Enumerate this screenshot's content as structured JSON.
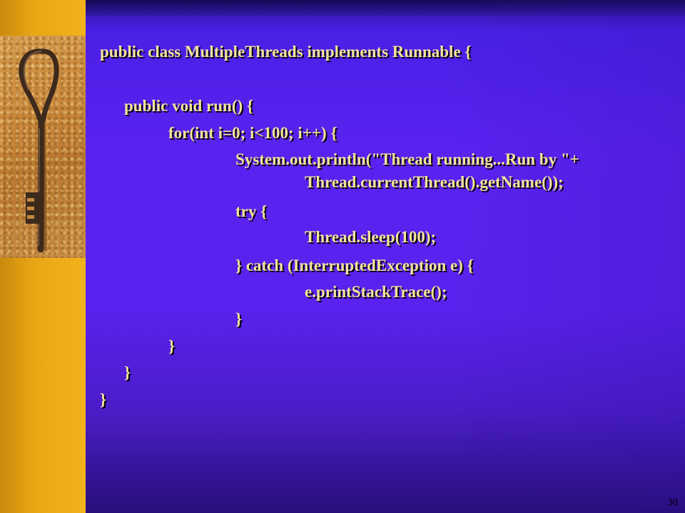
{
  "slide": {
    "code_lines": [
      "public class MultipleThreads implements Runnable {",
      "public void run() {",
      "for(int i=0; i<100; i++) {",
      "System.out.println(\"Thread running...Run by \"+",
      "Thread.currentThread().getName());",
      "try {",
      "Thread.sleep(100);",
      "} catch (InterruptedException e) {",
      "e.printStackTrace();",
      "}",
      "}",
      "}",
      "}"
    ],
    "page_number": "30"
  },
  "colors": {
    "text": "#f2e39a",
    "panel": "#5a22f0",
    "strip": "#f2b21c"
  },
  "decoration": {
    "photo": "antique-key-on-sand"
  }
}
